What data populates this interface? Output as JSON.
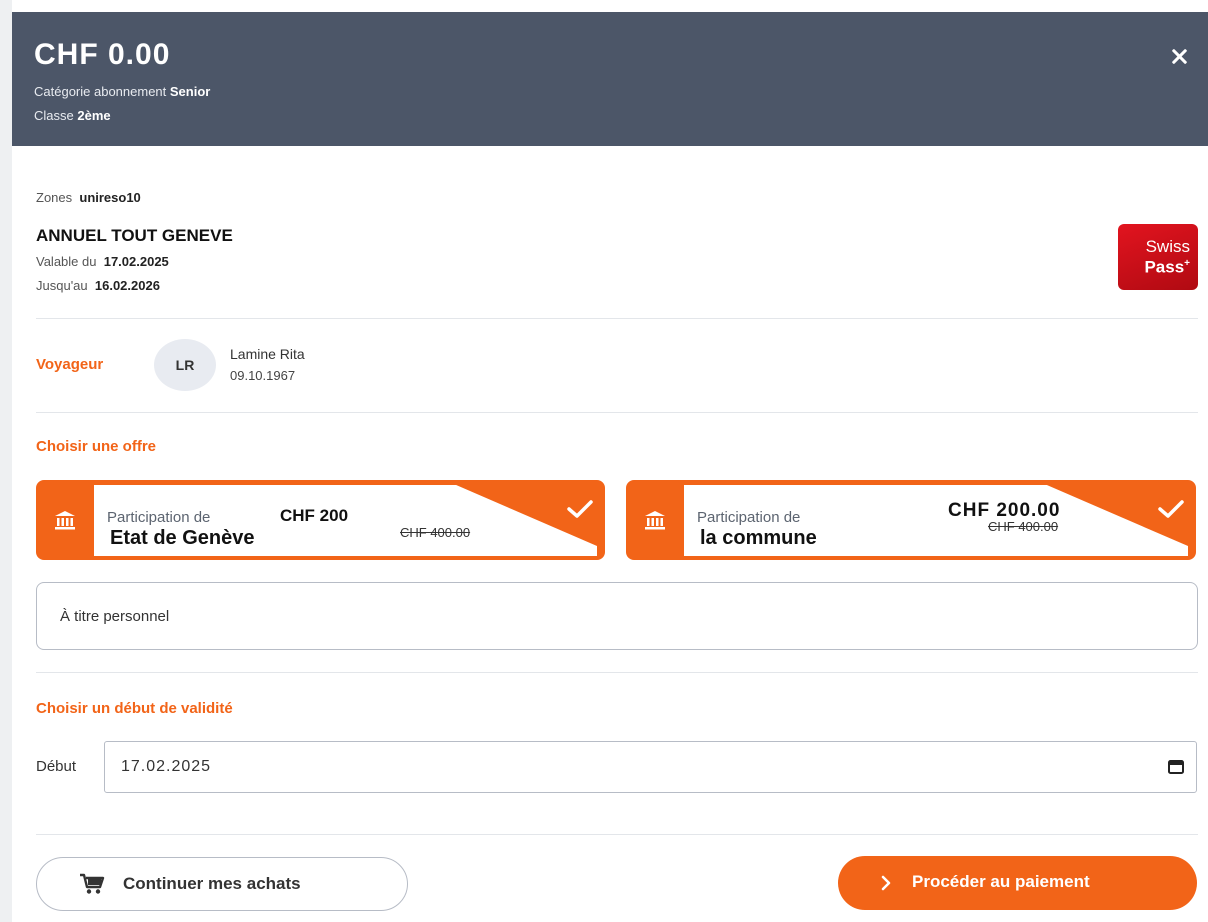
{
  "header": {
    "amount": "CHF 0.00",
    "category_label": "Catégorie abonnement",
    "category_value": "Senior",
    "class_label": "Classe",
    "class_value": "2ème"
  },
  "product": {
    "zones_label": "Zones",
    "zones_value": "unireso10",
    "title": "ANNUEL TOUT GENEVE",
    "valid_from_label": "Valable du",
    "valid_from_value": "17.02.2025",
    "valid_to_label": "Jusqu'au",
    "valid_to_value": "16.02.2026",
    "logo_line1": "Swiss",
    "logo_line2": "Pass",
    "logo_plus": "+"
  },
  "traveler": {
    "label": "Voyageur",
    "initials": "LR",
    "name": "Lamine Rita",
    "birthdate": "09.10.1967"
  },
  "offers": {
    "section_title": "Choisir une offre",
    "items": [
      {
        "label": "Participation de",
        "entity": "Etat de Genève",
        "price": "CHF 200",
        "old_price": "CHF 400.00",
        "selected": true
      },
      {
        "label": "Participation de",
        "entity": "la commune",
        "price": "CHF 200.00",
        "old_price": "CHF 400.00",
        "selected": true
      }
    ],
    "personal_option": "À titre personnel"
  },
  "validity": {
    "section_title": "Choisir un début de validité",
    "start_label": "Début",
    "start_value": "17.02.2025"
  },
  "actions": {
    "continue_label": "Continuer mes achats",
    "pay_label": "Procéder au paiement"
  },
  "colors": {
    "accent": "#f26418",
    "header_bg": "#4c5668",
    "swisspass_red": "#d0121b"
  },
  "icons": {
    "close": "close-icon",
    "bank": "bank-icon",
    "check": "check-icon",
    "calendar": "calendar-icon",
    "cart": "cart-icon",
    "chevron": "chevron-right-icon"
  }
}
